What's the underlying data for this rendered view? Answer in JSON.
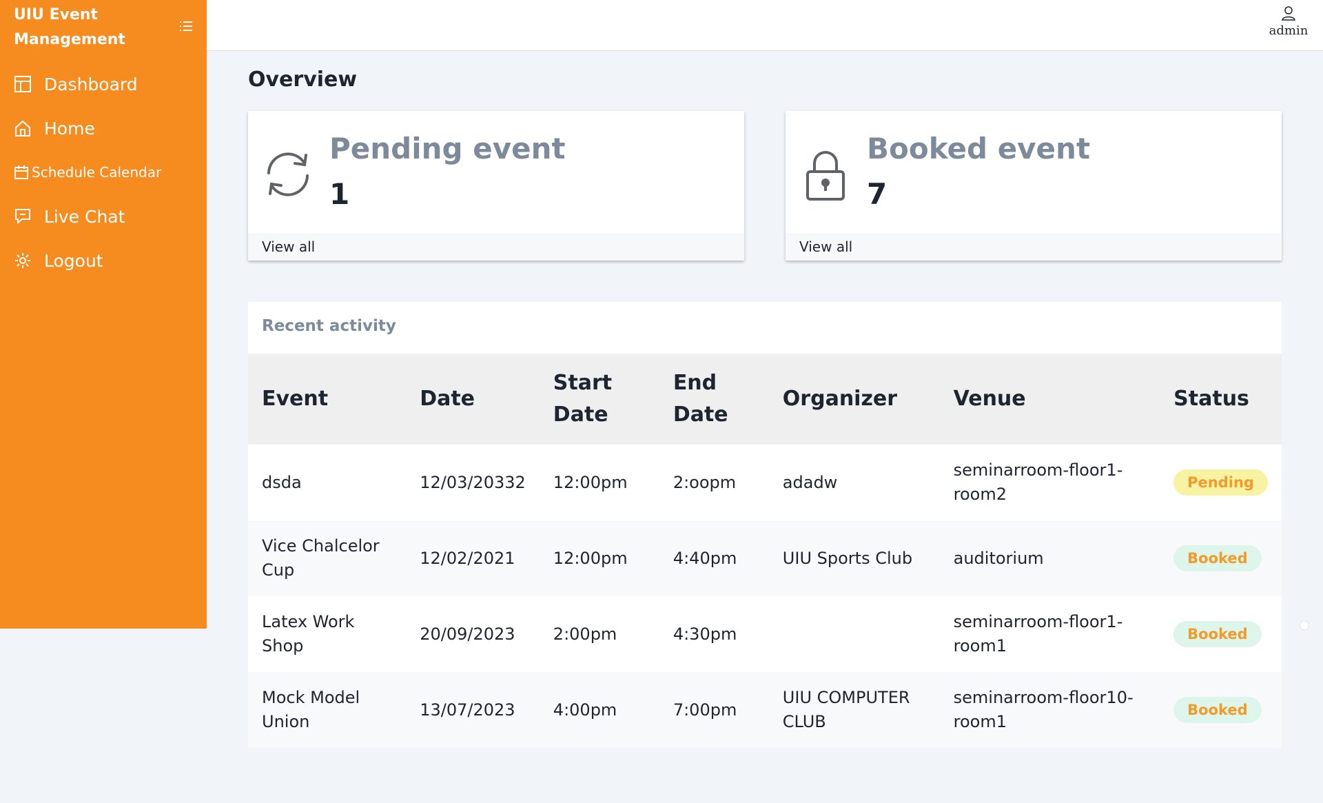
{
  "sidebar": {
    "brand": "UIU Event Management",
    "items": [
      {
        "label": "Dashboard",
        "icon": "dashboard-icon"
      },
      {
        "label": "Home",
        "icon": "home-icon"
      },
      {
        "label": "Schedule Calendar",
        "icon": "calendar-icon"
      },
      {
        "label": "Live Chat",
        "icon": "chat-icon"
      },
      {
        "label": "Logout",
        "icon": "gear-icon"
      }
    ]
  },
  "topbar": {
    "user": "admin"
  },
  "overview": {
    "title": "Overview",
    "cards": [
      {
        "title": "Pending event",
        "count": "1",
        "link": "View all",
        "icon": "refresh-icon"
      },
      {
        "title": "Booked event",
        "count": "7",
        "link": "View all",
        "icon": "lock-icon"
      }
    ]
  },
  "activity": {
    "title": "Recent activity",
    "columns": [
      "Event",
      "Date",
      "Start Date",
      "End Date",
      "Organizer",
      "Venue",
      "Status"
    ],
    "rows": [
      {
        "event": "dsda",
        "date": "12/03/20332",
        "start": "12:00pm",
        "end": "2:oopm",
        "organizer": "adadw",
        "venue": "seminarroom-floor1-room2",
        "status": "Pending"
      },
      {
        "event": "Vice Chalcelor Cup",
        "date": "12/02/2021",
        "start": "12:00pm",
        "end": "4:40pm",
        "organizer": "UIU Sports Club",
        "venue": "auditorium",
        "status": "Booked"
      },
      {
        "event": "Latex Work Shop",
        "date": "20/09/2023",
        "start": "2:00pm",
        "end": "4:30pm",
        "organizer": "",
        "venue": "seminarroom-floor1-room1",
        "status": "Booked"
      },
      {
        "event": "Mock Model Union",
        "date": "13/07/2023",
        "start": "4:00pm",
        "end": "7:00pm",
        "organizer": "UIU COMPUTER CLUB",
        "venue": "seminarroom-floor10-room1",
        "status": "Booked"
      }
    ]
  },
  "colors": {
    "sidebar": "#f68c1f",
    "pending_badge": "#f8f3a3",
    "booked_badge": "#ddf5ea",
    "badge_text": "#f29a2a"
  }
}
